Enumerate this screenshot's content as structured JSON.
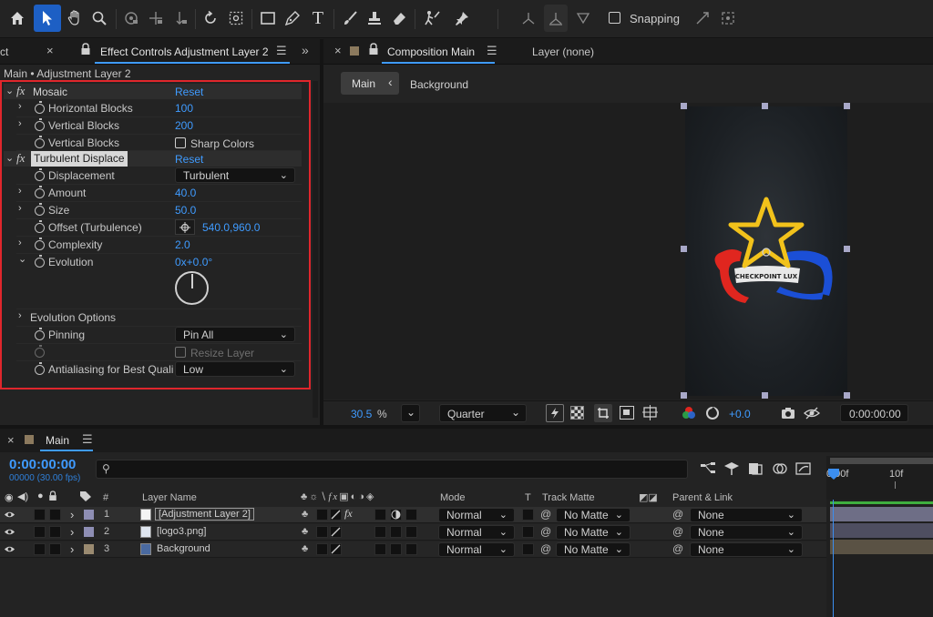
{
  "toolbar": {
    "snapping_label": "Snapping",
    "tools": [
      "home-icon",
      "selection-arrow-icon",
      "hand-icon",
      "zoom-icon",
      "orbit-camera-icon",
      "pan-camera-icon",
      "dolly-camera-icon",
      "rotate-icon",
      "anchor-point-icon",
      "rectangle-icon",
      "pen-icon",
      "type-icon",
      "brush-icon",
      "clone-stamp-icon",
      "eraser-icon",
      "roto-brush-icon",
      "puppet-pin-icon"
    ]
  },
  "left_panel": {
    "tab_partial": "ct",
    "tab_title": "Effect Controls Adjustment Layer 2",
    "breadcrumb": "Main • Adjustment Layer 2",
    "effects": {
      "mosaic": {
        "name": "Mosaic",
        "reset": "Reset",
        "horizontal_blocks_label": "Horizontal Blocks",
        "horizontal_blocks_value": "100",
        "vertical_blocks_label": "Vertical Blocks",
        "vertical_blocks_value": "200",
        "sharp_colors_row_label": "Vertical Blocks",
        "sharp_colors_label": "Sharp Colors"
      },
      "turbulent": {
        "name": "Turbulent Displace",
        "reset": "Reset",
        "displacement_label": "Displacement",
        "displacement_value": "Turbulent",
        "amount_label": "Amount",
        "amount_value": "40.0",
        "size_label": "Size",
        "size_value": "50.0",
        "offset_label": "Offset (Turbulence)",
        "offset_value": "540.0,960.0",
        "complexity_label": "Complexity",
        "complexity_value": "2.0",
        "evolution_label": "Evolution",
        "evolution_value": "0x+0.0°",
        "evolution_options_label": "Evolution Options",
        "pinning_label": "Pinning",
        "pinning_value": "Pin All",
        "resize_layer_label": "Resize Layer",
        "antialiasing_label": "Antialiasing for Best Quali",
        "antialiasing_value": "Low"
      }
    }
  },
  "comp_panel": {
    "tab_title": "Composition Main",
    "layer_tab": "Layer (none)",
    "breadcrumb_main": "Main",
    "breadcrumb_background": "Background",
    "zoom_value": "30.5",
    "zoom_unit": "%",
    "resolution": "Quarter",
    "exposure": "+0.0",
    "timecode": "0:00:00:00",
    "artwork_text": "CHECKPOINT LUX"
  },
  "timeline": {
    "tab_title": "Main",
    "timecode": "0:00:00:00",
    "frames": "00000 (30.00 fps)",
    "search_placeholder": "",
    "columns": {
      "number": "#",
      "layer_name": "Layer Name",
      "mode": "Mode",
      "t": "T",
      "track_matte": "Track Matte",
      "parent_link": "Parent & Link"
    },
    "ruler": {
      "start": "0:00f",
      "mark": "10f"
    },
    "layers": [
      {
        "num": "1",
        "name": "[Adjustment Layer 2]",
        "mode": "Normal",
        "matte": "No Matte",
        "parent": "None",
        "color": "#8e8eb4"
      },
      {
        "num": "2",
        "name": "[logo3.png]",
        "mode": "Normal",
        "matte": "No Matte",
        "parent": "None",
        "color": "#8e8eb4"
      },
      {
        "num": "3",
        "name": "Background",
        "mode": "Normal",
        "matte": "No Matte",
        "parent": "None",
        "color": "#9a8a70"
      }
    ]
  },
  "colors": {
    "accent_blue": "#3f9bff",
    "highlight_red": "#e0262c",
    "panel_bg": "#232323",
    "star_yellow": "#f2c21b",
    "swoosh_red": "#e0261f",
    "swoosh_blue": "#1b4fd6",
    "playhead": "#3b8ef0"
  }
}
